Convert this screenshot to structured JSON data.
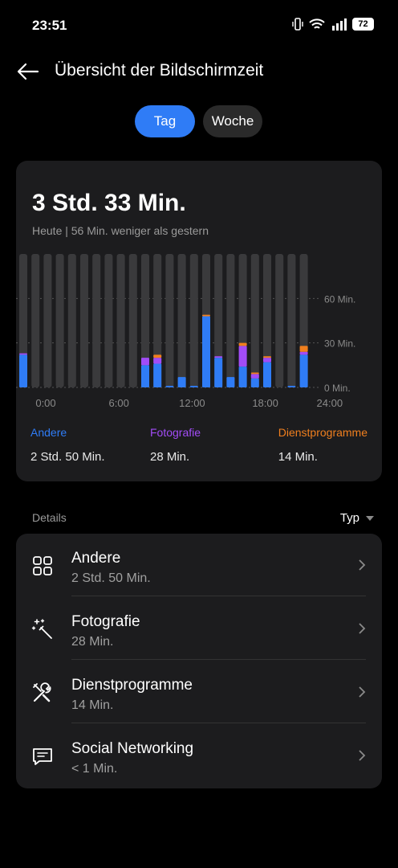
{
  "status_bar": {
    "time": "23:51",
    "battery": "72"
  },
  "header": {
    "title": "Übersicht der Bildschirmzeit"
  },
  "tabs": [
    {
      "label": "Tag",
      "active": true
    },
    {
      "label": "Woche",
      "active": false
    }
  ],
  "summary": {
    "total": "3 Std. 33 Min.",
    "comparison": "Heute | 56 Min. weniger als gestern"
  },
  "colors": {
    "andere": "#2f7cf6",
    "fotografie": "#a24cf7",
    "dienstprogramme": "#f07f1e",
    "track": "#3a3a3c"
  },
  "chart_data": {
    "type": "bar",
    "stacked": true,
    "categories": [
      "0",
      "1",
      "2",
      "3",
      "4",
      "5",
      "6",
      "7",
      "8",
      "9",
      "10",
      "11",
      "12",
      "13",
      "14",
      "15",
      "16",
      "17",
      "18",
      "19",
      "20",
      "21",
      "22",
      "23"
    ],
    "series": [
      {
        "name": "Andere",
        "values": [
          22,
          0,
          0,
          0,
          0,
          0,
          0,
          0,
          0,
          0,
          15,
          16,
          1,
          7,
          1,
          48,
          20,
          7,
          14,
          6,
          17,
          0,
          1,
          22
        ]
      },
      {
        "name": "Fotografie",
        "values": [
          1,
          0,
          0,
          0,
          0,
          0,
          0,
          0,
          0,
          0,
          5,
          4,
          0,
          0,
          0,
          0,
          1,
          0,
          14,
          3,
          3,
          0,
          0,
          2
        ]
      },
      {
        "name": "Dienstprogramme",
        "values": [
          0,
          0,
          0,
          0,
          0,
          0,
          0,
          0,
          0,
          0,
          0,
          2,
          0,
          0,
          0,
          1,
          0,
          0,
          2,
          1,
          1,
          0,
          0,
          4
        ]
      }
    ],
    "ylim": [
      0,
      90
    ],
    "y_ticks": [
      "0 Min.",
      "30 Min.",
      "60 Min."
    ],
    "x_ticks": [
      "0:00",
      "6:00",
      "12:00",
      "18:00",
      "24:00"
    ]
  },
  "legend": [
    {
      "label": "Andere",
      "value": "2 Std. 50 Min."
    },
    {
      "label": "Fotografie",
      "value": "28 Min."
    },
    {
      "label": "Dienstprogramme",
      "value": "14 Min."
    }
  ],
  "details": {
    "label": "Details",
    "sort_label": "Typ",
    "items": [
      {
        "name": "Andere",
        "time": "2 Std. 50 Min.",
        "icon": "grid-icon"
      },
      {
        "name": "Fotografie",
        "time": "28 Min.",
        "icon": "magic-wand-icon"
      },
      {
        "name": "Dienstprogramme",
        "time": "14 Min.",
        "icon": "tools-icon"
      },
      {
        "name": "Social Networking",
        "time": "< 1 Min.",
        "icon": "chat-icon"
      }
    ]
  }
}
